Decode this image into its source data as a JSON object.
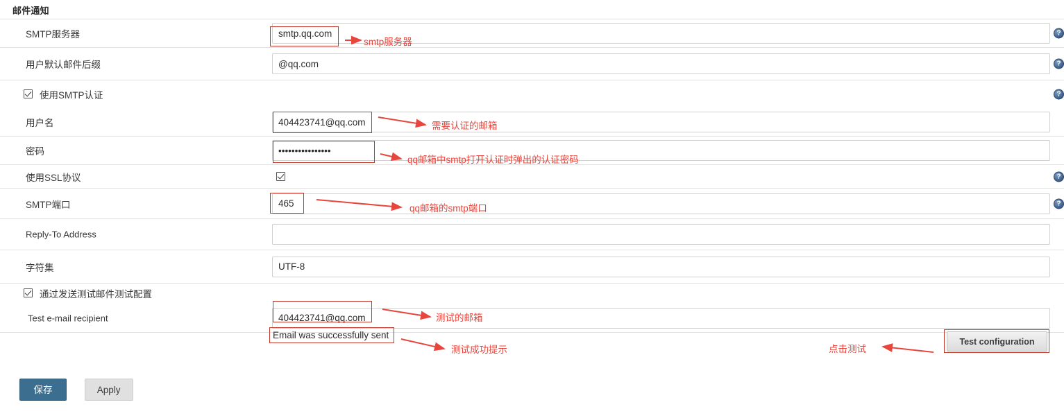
{
  "section": {
    "title": "邮件通知"
  },
  "rows": [
    {
      "id": "smtp-server",
      "label": "SMTP服务器",
      "value": "smtp.qq.com",
      "placeholder": "",
      "help": "?"
    },
    {
      "id": "default-mail-suffix",
      "label": "用户默认邮件后缀",
      "value": "@qq.com",
      "placeholder": "",
      "help": "?"
    },
    {
      "id": "use-smtp-auth",
      "label": "使用SMTP认证",
      "checked": true,
      "help": "?"
    },
    {
      "id": "username",
      "label": "用户名",
      "value": "404423741@qq.com",
      "placeholder": "",
      "help": ""
    },
    {
      "id": "password",
      "label": "密码",
      "value": "••••••••••••••••",
      "placeholder": "",
      "help": ""
    },
    {
      "id": "use-ssl",
      "label": "使用SSL协议",
      "checked": true,
      "help": "?"
    },
    {
      "id": "smtp-port",
      "label": "SMTP端口",
      "value": "465",
      "placeholder": "",
      "help": "?"
    },
    {
      "id": "reply-to-address",
      "label": "Reply-To Address",
      "value": "",
      "placeholder": "",
      "help": ""
    },
    {
      "id": "charset",
      "label": "字符集",
      "value": "UTF-8",
      "placeholder": "",
      "help": ""
    },
    {
      "id": "test-by-sending",
      "label": "通过发送测试邮件测试配置",
      "checked": true,
      "help": ""
    },
    {
      "id": "test-recipient",
      "label": "Test e-mail recipient",
      "value": "404423741@qq.com",
      "placeholder": "",
      "help": ""
    }
  ],
  "test_result": {
    "message": "Email was successfully sent"
  },
  "test_button": {
    "label": "Test configuration"
  },
  "footer": {
    "save_label": "保存",
    "apply_label": "Apply"
  },
  "annotations": [
    {
      "id": "anno-smtp-server",
      "text": "smtp服务器"
    },
    {
      "id": "anno-username",
      "text": "需要认证的邮箱"
    },
    {
      "id": "anno-password",
      "text": "qq邮箱中smtp打开认证时弹出的认证密码"
    },
    {
      "id": "anno-smtp-port",
      "text": "qq邮箱的smtp端口"
    },
    {
      "id": "anno-test-recipient",
      "text": "测试的邮箱"
    },
    {
      "id": "anno-test-result",
      "text": "测试成功提示"
    },
    {
      "id": "anno-test-button",
      "text": "点击测试"
    }
  ],
  "colors": {
    "annotation": "#e8453c",
    "save_button": "#3b6e8f",
    "field_border": "#d0d0d0"
  }
}
